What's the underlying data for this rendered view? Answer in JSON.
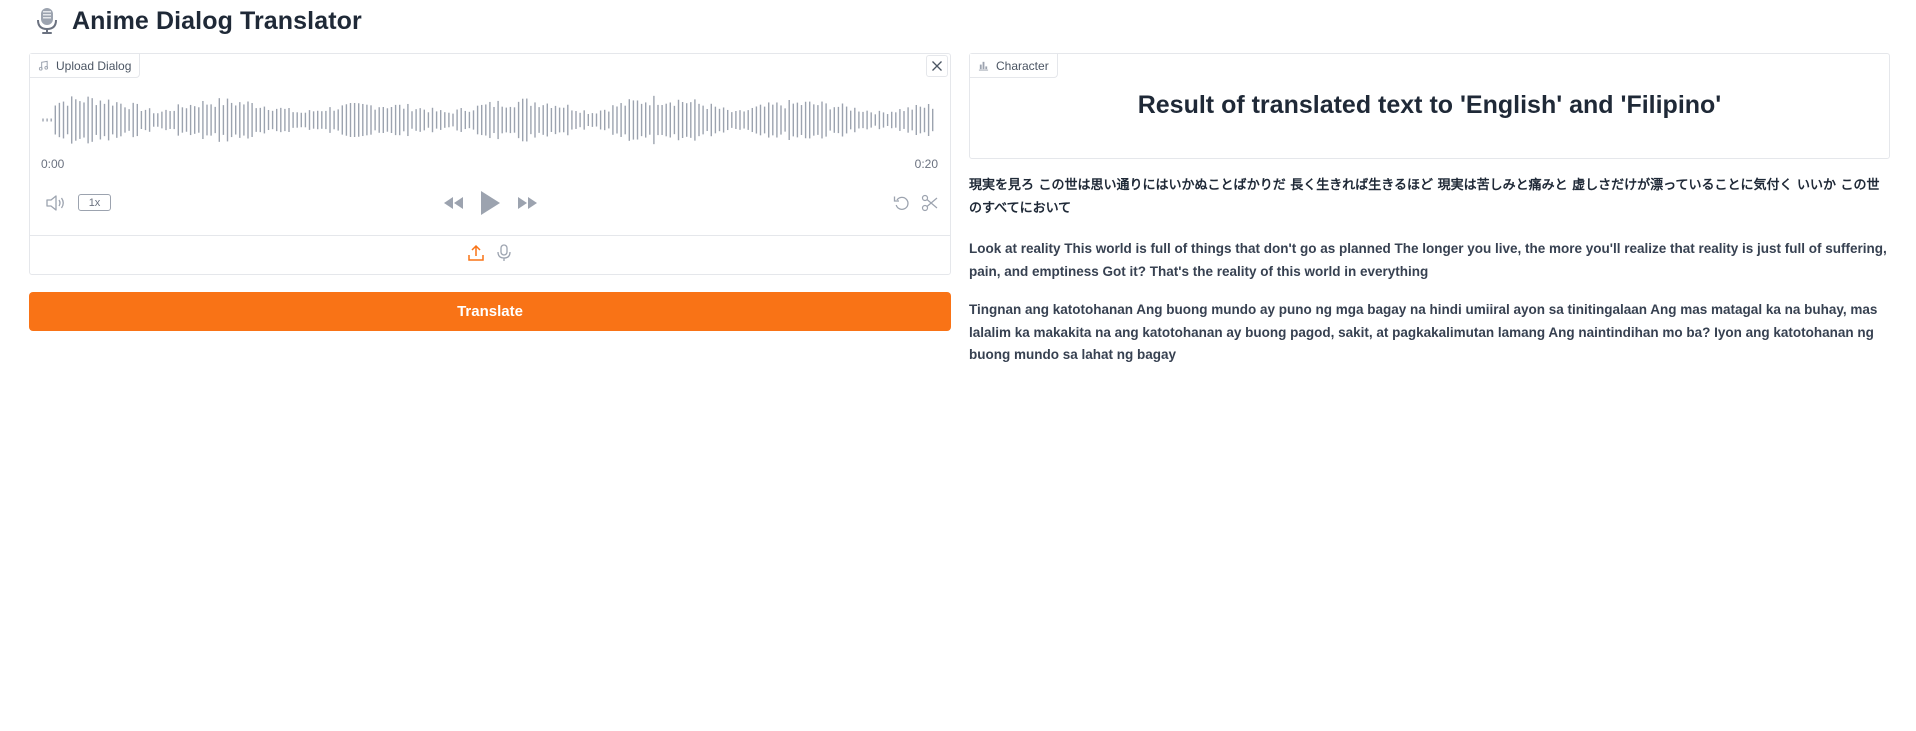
{
  "app": {
    "title": "Anime Dialog Translator"
  },
  "audio": {
    "label": "Upload Dialog",
    "time_start": "0:00",
    "time_end": "0:20",
    "speed": "1x"
  },
  "translate_button": "Translate",
  "character": {
    "label": "Character",
    "heading": "Result of translated text to 'English' and 'Filipino'"
  },
  "outputs": {
    "japanese": "現実を見ろ この世は思い通りにはいかぬことばかりだ 長く生きれば生きるほど 現実は苦しみと痛みと 虚しさだけが漂っていることに気付く いいか この世のすべてにおいて",
    "english": "Look at reality This world is full of things that don't go as planned The longer you live, the more you'll realize that reality is just full of suffering, pain, and emptiness Got it? That's the reality of this world in everything",
    "filipino": "Tingnan ang katotohanan Ang buong mundo ay puno ng mga bagay na hindi umiiral ayon sa tinitingalaan Ang mas matagal ka na buhay, mas lalalim ka makakita na ang katotohanan ay buong pagod, sakit, at pagkakalimutan lamang Ang naintindihan mo ba? Iyon ang katotohanan ng buong mundo sa lahat ng bagay"
  },
  "colors": {
    "accent": "#f97316",
    "waveform": "#9ca3af",
    "border": "#e5e7eb"
  },
  "icons": [
    "microphone-icon",
    "music-note-icon",
    "close-icon",
    "volume-icon",
    "rewind-icon",
    "play-icon",
    "fast-forward-icon",
    "undo-icon",
    "scissors-icon",
    "upload-icon",
    "record-icon",
    "chart-icon"
  ]
}
